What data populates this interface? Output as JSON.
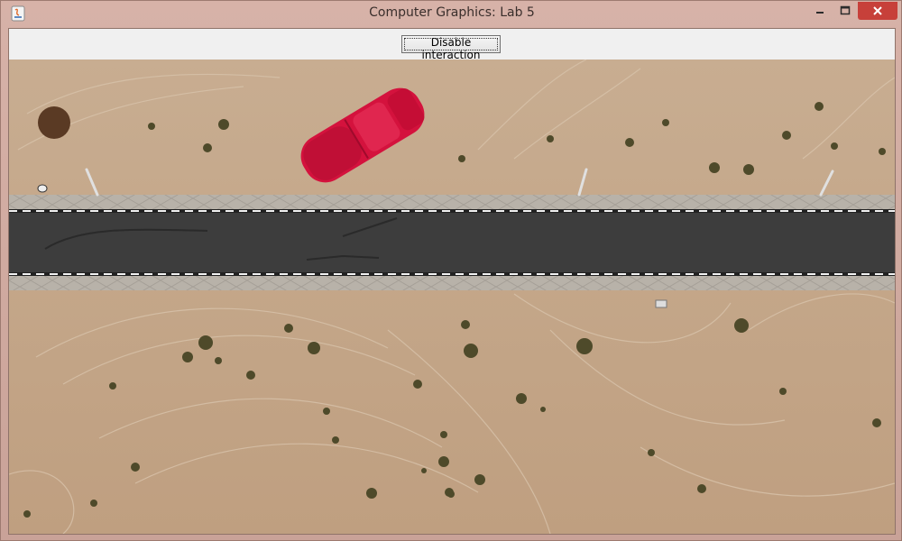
{
  "window": {
    "title": "Computer Graphics: Lab 5"
  },
  "toolbar": {
    "toggle_button_label": "Disable interaction"
  },
  "scene": {
    "car_color": "#d4123d",
    "icons": [
      "java-app-icon",
      "minimize-icon",
      "maximize-icon",
      "close-icon",
      "car-icon"
    ]
  }
}
